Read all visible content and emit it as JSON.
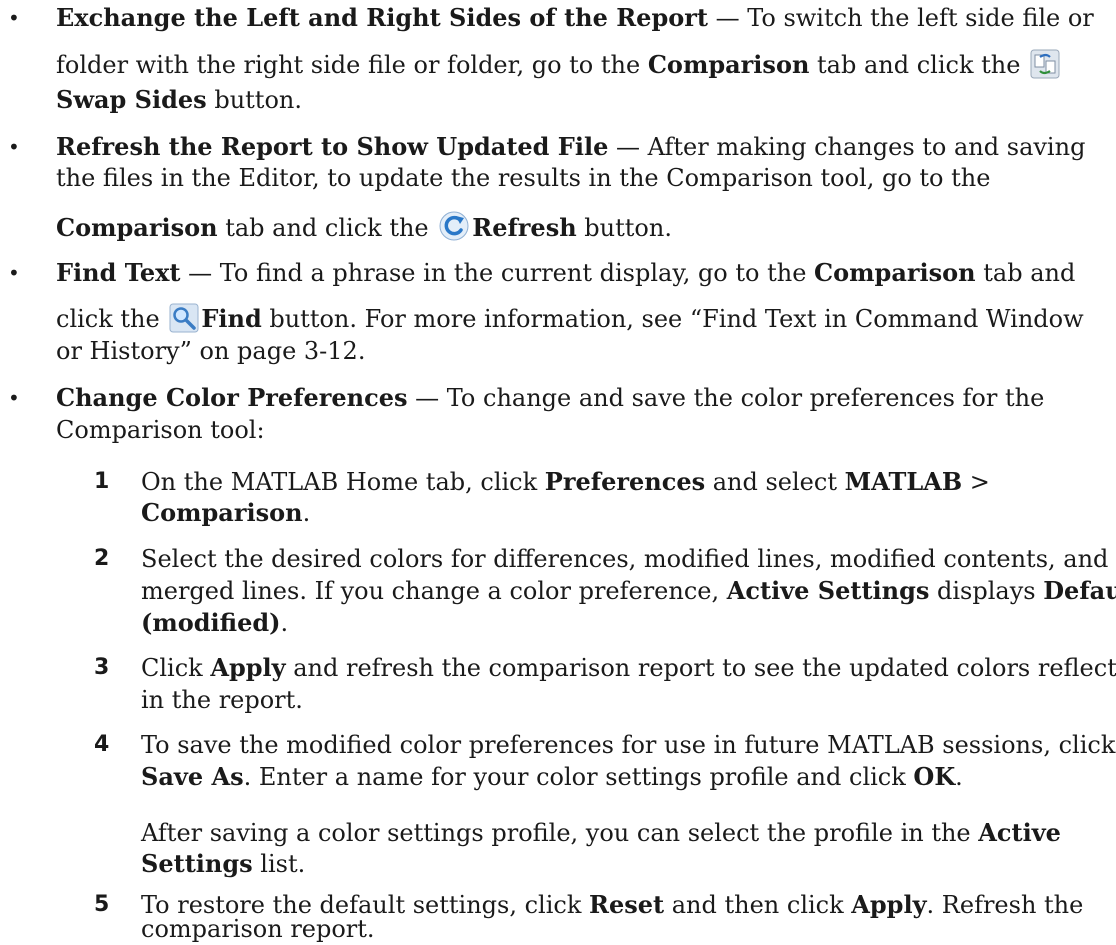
{
  "bullets": [
    {
      "title": "Exchange the Left and Right Sides of the Report",
      "text1": " — To switch the left side file or",
      "text2": "folder with the right side file or folder, go to the ",
      "tab": "Comparison",
      "text3": " tab and click the ",
      "icon": "swap-sides-icon",
      "button": "Swap Sides",
      "text4": " button."
    },
    {
      "title": "Refresh the Report to Show Updated File",
      "text1": " — After making changes to and saving",
      "text2": "the files in the Editor, to update the results in the Comparison tool, go to the",
      "tab": "Comparison",
      "text3": " tab and click the ",
      "icon": "refresh-icon",
      "button": "Refresh",
      "text4": " button."
    },
    {
      "title": "Find Text",
      "text1": " — To find a phrase in the current display, go to the ",
      "tab": "Comparison",
      "text2": " tab and",
      "text3": "click the ",
      "icon": "find-icon",
      "button": "Find",
      "text4": " button. For more information, see “Find Text in Command Window",
      "text5": "or History” on page 3-12."
    },
    {
      "title": "Change Color Preferences",
      "text1": " — To change and save the color preferences for the",
      "text2": "Comparison tool:"
    }
  ],
  "steps": [
    {
      "num": "1",
      "a": "On the MATLAB Home tab, click ",
      "b1": "Preferences",
      "c": " and select ",
      "b2": "MATLAB",
      "d": " >",
      "b3": "Comparison",
      "e": "."
    },
    {
      "num": "2",
      "l1": "Select the desired colors for differences, modified lines, modified contents, and",
      "l2a": "merged lines. If you change a color preference, ",
      "b1": "Active Settings",
      "l2b": " displays ",
      "b2": "Default",
      "b3": "(modified)",
      "l3": "."
    },
    {
      "num": "3",
      "a": "Click ",
      "b1": "Apply",
      "l1": " and refresh the comparison report to see the updated colors reflected",
      "l2": "in the report."
    },
    {
      "num": "4",
      "l1": "To save the modified color preferences for use in future MATLAB sessions, click",
      "b1": "Save As",
      "l2a": ". Enter a name for your color settings profile and click ",
      "b2": "OK",
      "l2b": ".",
      "p1": "After saving a color settings profile, you can select the profile in the ",
      "b3": "Active",
      "b4": "Settings",
      "p2": " list."
    },
    {
      "num": "5",
      "a": "To restore the default settings, click ",
      "b1": "Reset",
      "c": " and then click ",
      "b2": "Apply",
      "d": ". Refresh the",
      "l2": "comparison report."
    }
  ],
  "bullet_symbol": "•"
}
